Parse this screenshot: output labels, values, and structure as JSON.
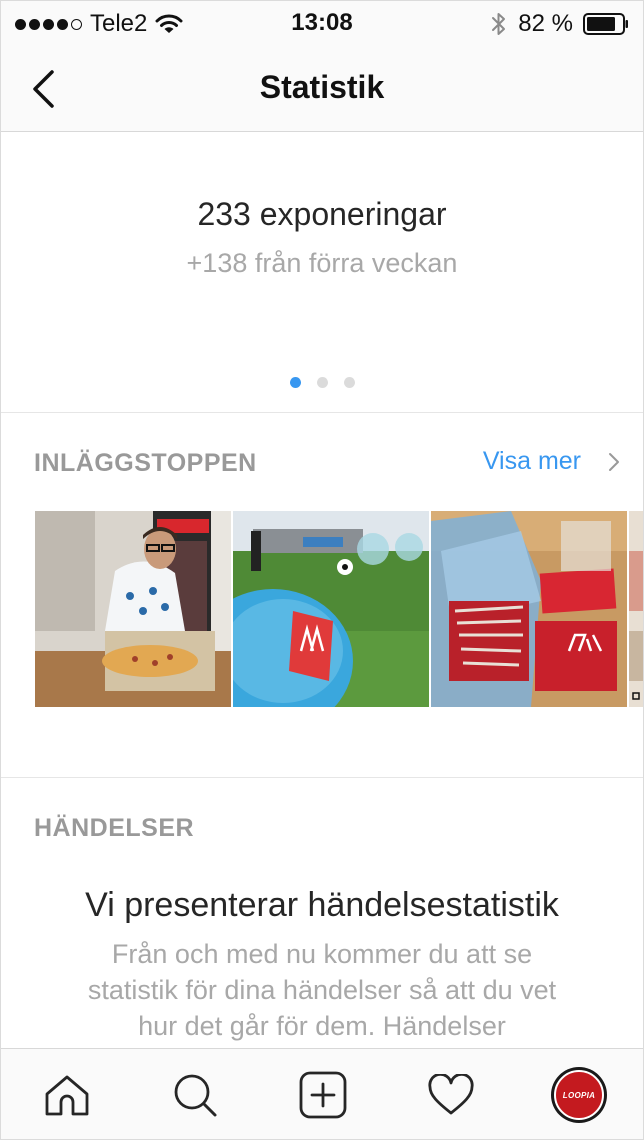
{
  "status_bar": {
    "carrier": "Tele2",
    "time": "13:08",
    "battery_percent": "82 %",
    "signal_bars_filled": 4,
    "signal_bars_total": 5
  },
  "nav": {
    "title": "Statistik",
    "back_icon": "chevron-left-icon"
  },
  "metric": {
    "value": "233 exponeringar",
    "change": "+138 från förra veckan",
    "pager": {
      "pages": 3,
      "active": 0
    }
  },
  "top_posts": {
    "title": "INLÄGGSTOPPEN",
    "see_more": "Visa mer",
    "posts": [
      {
        "name": "post-thumbnail-pizza"
      },
      {
        "name": "post-thumbnail-bubble-football"
      },
      {
        "name": "post-thumbnail-merchandise-box"
      },
      {
        "name": "post-thumbnail-partial"
      }
    ]
  },
  "events": {
    "title": "HÄNDELSER",
    "heading": "Vi presenterar händelsestatistik",
    "body": "Från och med nu kommer du att se statistik för dina händelser så att du vet hur det går för dem. Händelser"
  },
  "tab_bar": {
    "items": [
      {
        "name": "home",
        "icon": "home-icon"
      },
      {
        "name": "search",
        "icon": "search-icon"
      },
      {
        "name": "new-post",
        "icon": "plus-square-icon"
      },
      {
        "name": "activity",
        "icon": "heart-icon"
      },
      {
        "name": "profile",
        "icon": "avatar"
      }
    ],
    "profile_logo_text": "LOOPIA"
  },
  "colors": {
    "accent_blue": "#3897f0",
    "text_dark": "#262626",
    "text_muted": "#a8a8a8",
    "section_gray": "#999999",
    "bar_background": "#fafafa",
    "profile_red": "#c41a1f"
  }
}
